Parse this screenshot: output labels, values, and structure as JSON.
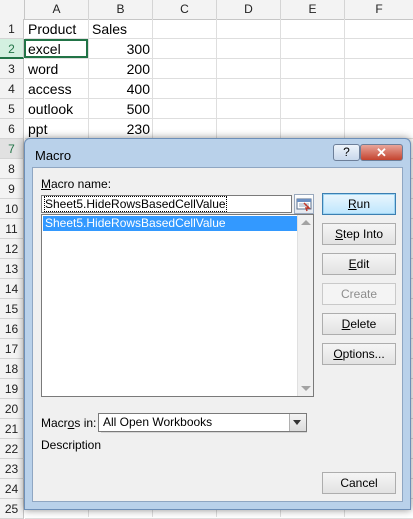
{
  "spreadsheet": {
    "columns": [
      "A",
      "B",
      "C",
      "D",
      "E",
      "F"
    ],
    "rows": [
      "1",
      "2",
      "3",
      "4",
      "5",
      "6",
      "7",
      "8",
      "9",
      "10",
      "11",
      "12",
      "13",
      "14",
      "15",
      "16",
      "17",
      "18",
      "19",
      "20",
      "21",
      "22",
      "23",
      "24",
      "25"
    ],
    "data": [
      {
        "product": "Product",
        "sales": "Sales"
      },
      {
        "product": "excel",
        "sales": "300"
      },
      {
        "product": "word",
        "sales": "200"
      },
      {
        "product": "access",
        "sales": "400"
      },
      {
        "product": "outlook",
        "sales": "500"
      },
      {
        "product": "ppt",
        "sales": "230"
      }
    ],
    "selected_row": "2",
    "highlighted_row": "7"
  },
  "dialog": {
    "title": "Macro",
    "help_label": "?",
    "close_label": "✕",
    "macro_name_label": "Macro name:",
    "macro_name_value": "Sheet5.HideRowsBasedCellValue",
    "macro_list": [
      "Sheet5.HideRowsBasedCellValue"
    ],
    "buttons": {
      "run": "Run",
      "step_into": "Step Into",
      "edit": "Edit",
      "create": "Create",
      "delete": "Delete",
      "options": "Options...",
      "cancel": "Cancel"
    },
    "macros_in_label": "Macros in:",
    "macros_in_value": "All Open Workbooks",
    "description_label": "Description"
  },
  "colors": {
    "excel_green": "#217346",
    "selection_blue": "#3399ff",
    "dialog_frame": "#b9d1ea"
  }
}
